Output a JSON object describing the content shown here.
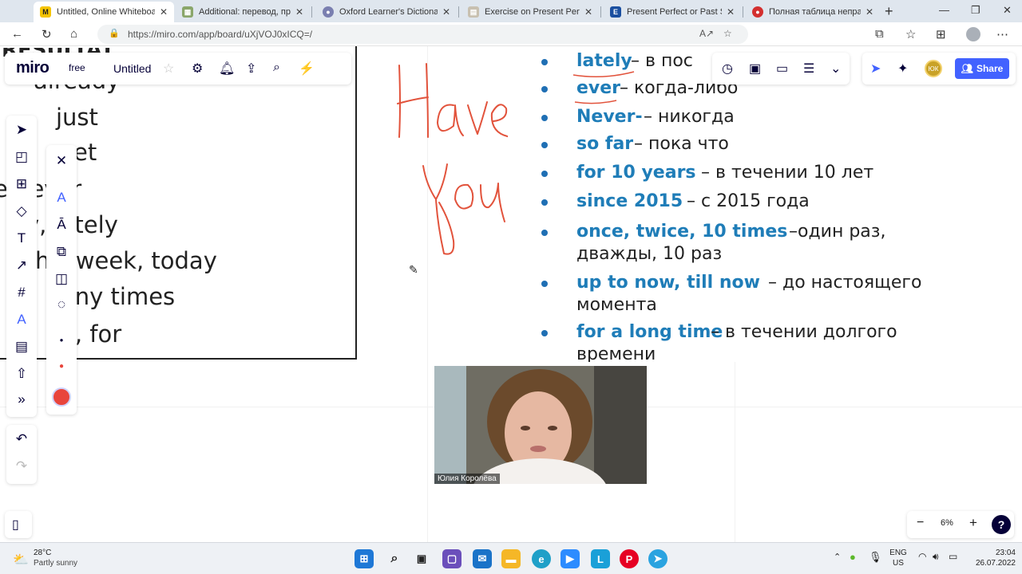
{
  "browser": {
    "tabs": [
      {
        "label": "Untitled, Online Whiteboard",
        "active": true,
        "favicon_color": "#f5c400",
        "favicon_glyph": "M"
      },
      {
        "label": "Additional: перевод, прои",
        "favicon_color": "#8aa66a",
        "favicon_glyph": "▦"
      },
      {
        "label": "Oxford Learner's Dictionarie",
        "favicon_color": "#7a7fb0",
        "favicon_glyph": "●"
      },
      {
        "label": "Exercise on Present Perfect",
        "favicon_color": "#c8c0b0",
        "favicon_glyph": "▤"
      },
      {
        "label": "Present Perfect or Past Simp",
        "favicon_color": "#1a4fa0",
        "favicon_glyph": "E"
      },
      {
        "label": "Полная таблица неправил",
        "favicon_color": "#d32f2f",
        "favicon_glyph": "●"
      }
    ],
    "tab_close_glyph": "✕",
    "new_tab_glyph": "+",
    "url": "https://miro.com/app/board/uXjVOJ0xICQ=/",
    "extensions": [
      {
        "name": "extension-green-icon",
        "color": "#5cb82a",
        "glyph": "●"
      },
      {
        "name": "extension-opera-icon",
        "color": "#e02020",
        "glyph": "O"
      },
      {
        "name": "extension-download-icon",
        "color": "#3aa830",
        "glyph": "⬇"
      },
      {
        "name": "extension-fox-icon",
        "color": "#e8822a",
        "glyph": "▲"
      }
    ]
  },
  "miro": {
    "logo": "miro",
    "plan": "free",
    "board_title": "Untitled",
    "share_label": "Share",
    "avatar_initials": "ЮК",
    "zoom_level": "6%",
    "help_label": "?",
    "selected_color": "#e8453c"
  },
  "slide_left": {
    "cut_top": "RESULTAT",
    "words": [
      {
        "text": "already"
      },
      {
        "text": "just"
      },
      {
        "text": "et"
      },
      {
        "text": "e  never"
      },
      {
        "text": "y, lately"
      },
      {
        "text": "his week, today"
      },
      {
        "text": "any times"
      },
      {
        "text": "e, for"
      }
    ]
  },
  "handwriting": {
    "color": "#e2533c",
    "text_line1": "Have",
    "text_line2": "you"
  },
  "slide_right": {
    "items": [
      {
        "term": "lately",
        "translation": "– в пос"
      },
      {
        "term": "ever",
        "translation": "– когда-либо"
      },
      {
        "term": "Never-",
        "translation": "– никогда"
      },
      {
        "term": "so far",
        "translation": "– пока что"
      },
      {
        "term": "for 10 years",
        "translation": "– в течении 10 лет"
      },
      {
        "term": "since 2015",
        "translation": "– с 2015 года"
      },
      {
        "term": "once, twice, 10 times",
        "translation": "–один раз,",
        "line2": "дважды, 10 раз"
      },
      {
        "term": "up to now, till now",
        "translation": "– до настоящего",
        "line2": "момента"
      },
      {
        "term": "for a long time",
        "translation": "– в течении долгого",
        "line2": "времени"
      }
    ]
  },
  "video": {
    "participant_name": "Юлия Королёва"
  },
  "taskbar": {
    "temperature": "28°C",
    "weather_desc": "Partly sunny",
    "lang_top": "ENG",
    "lang_bottom": "US",
    "time": "23:04",
    "date": "26.07.2022"
  }
}
